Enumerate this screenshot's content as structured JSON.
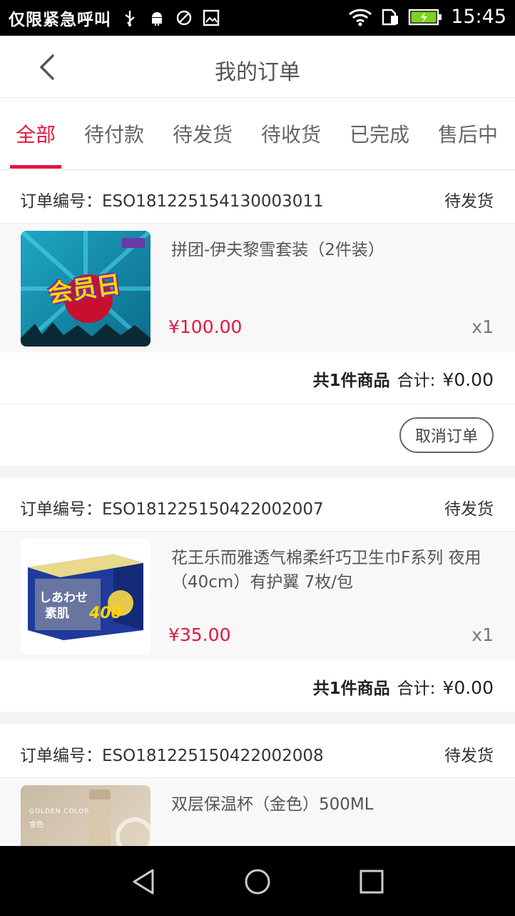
{
  "status_bar": {
    "carrier": "仅限紧急呼叫",
    "time": "15:45"
  },
  "header": {
    "title": "我的订单"
  },
  "tabs": [
    "全部",
    "待付款",
    "待发货",
    "待收货",
    "已完成",
    "售后中"
  ],
  "active_tab": 0,
  "orders": [
    {
      "order_no": "订单编号：ESO181225154130003011",
      "status": "待发货",
      "item_name": "拼团-伊夫黎雪套装（2件装）",
      "price": "¥100.00",
      "qty": "x1",
      "count_text": "共1件商品",
      "total_label": "合计:",
      "total": "¥0.00",
      "action": "取消订单",
      "thumb_text": "会员日"
    },
    {
      "order_no": "订单编号：ESO181225150422002007",
      "status": "待发货",
      "item_name": "花王乐而雅透气棉柔纤巧卫生巾F系列  夜用（40cm）有护翼 7枚/包",
      "price": "¥35.00",
      "qty": "x1",
      "count_text": "共1件商品",
      "total_label": "合计:",
      "total": "¥0.00",
      "thumb_text_1": "しあわせ",
      "thumb_text_2": "素肌",
      "thumb_text_3": "400"
    },
    {
      "order_no": "订单编号：ESO181225150422002008",
      "status": "待发货",
      "item_name": "双层保温杯（金色）500ML",
      "thumb_text_1": "GOLDEN COLOR",
      "thumb_text_2": "金色"
    }
  ],
  "colors": {
    "accent": "#e3173f",
    "background": "#f4f4f4"
  }
}
